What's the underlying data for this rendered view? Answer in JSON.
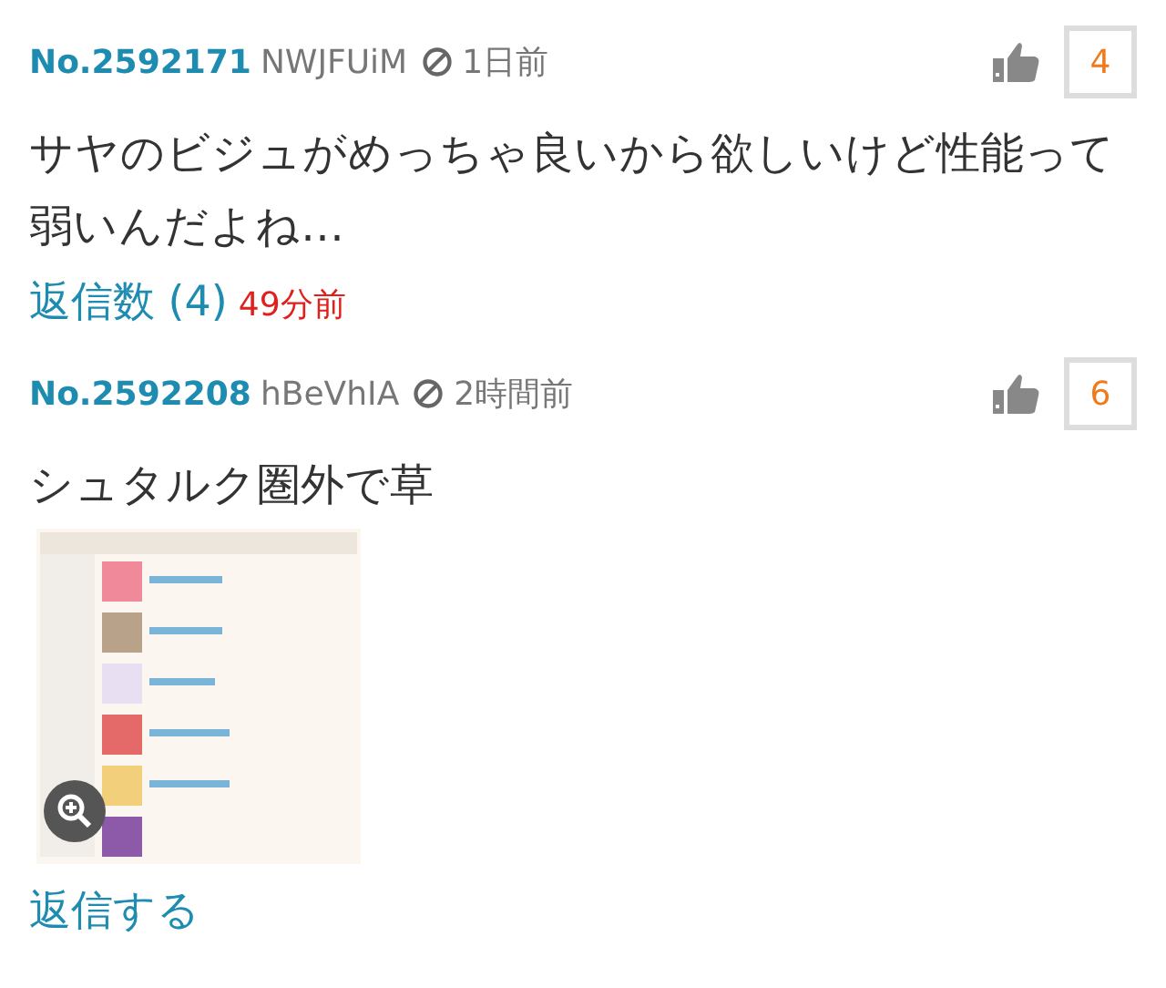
{
  "posts": [
    {
      "number": "No.2592171",
      "user_id": "NWJFUiM",
      "time": "1日前",
      "likes": "4",
      "body": "サヤのビジュがめっちゃ良いから欲しいけど性能って弱いんだよね…",
      "replies": "返信数 (4)",
      "reply_time": "49分前"
    },
    {
      "number": "No.2592208",
      "user_id": "hBeVhIA",
      "time": "2時間前",
      "likes": "6",
      "body": "シュタルク圏外で草",
      "reply_link": "返信する"
    }
  ]
}
